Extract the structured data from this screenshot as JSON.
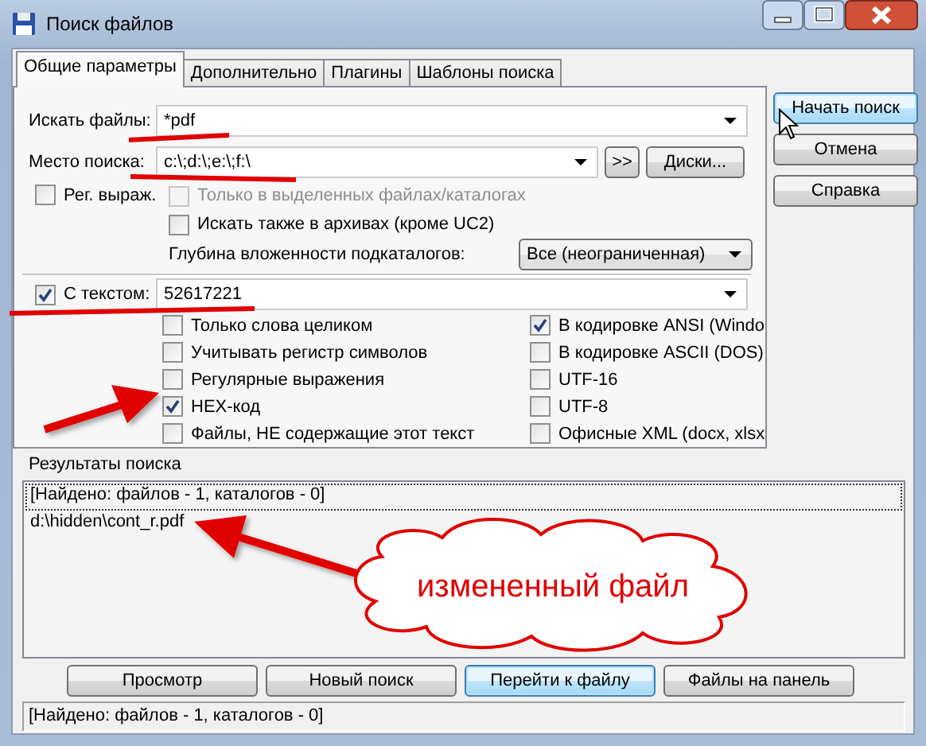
{
  "window": {
    "title": "Поиск файлов"
  },
  "tabs": [
    {
      "label": "Общие параметры",
      "selected": true
    },
    {
      "label": "Дополнительно",
      "selected": false
    },
    {
      "label": "Плагины",
      "selected": false
    },
    {
      "label": "Шаблоны поиска",
      "selected": false
    }
  ],
  "search_for": {
    "label": "Искать файлы:",
    "value": "*pdf"
  },
  "search_in": {
    "label": "Место поиска:",
    "value": "c:\\;d:\\;e:\\;f:\\",
    "browse_button": ">>",
    "drives_button": "Диски..."
  },
  "regex": {
    "label": "Рег. выраж.",
    "checked": false
  },
  "scope_options": [
    {
      "label": "Только в выделенных файлах/каталогах",
      "checked": false,
      "disabled": true
    },
    {
      "label": "Искать также в архивах (кроме UC2)",
      "checked": false,
      "disabled": false
    }
  ],
  "depth": {
    "label": "Глубина вложенности подкаталогов:",
    "value": "Все (неограниченная)"
  },
  "with_text": {
    "label": "С текстом:",
    "checked": true,
    "value": "52617221"
  },
  "text_options": [
    {
      "label": "Только слова целиком",
      "checked": false
    },
    {
      "label": "В кодировке ANSI (Windo",
      "checked": true
    },
    {
      "label": "Учитывать регистр символов",
      "checked": false
    },
    {
      "label": "В кодировке ASCII (DOS)",
      "checked": false
    },
    {
      "label": "Регулярные выражения",
      "checked": false
    },
    {
      "label": "UTF-16",
      "checked": false
    },
    {
      "label": "HEX-код",
      "checked": true
    },
    {
      "label": "UTF-8",
      "checked": false
    },
    {
      "label": "Файлы, НЕ содержащие этот текст",
      "checked": false
    },
    {
      "label": "Офисные XML (docx, xlsx",
      "checked": false
    }
  ],
  "side_buttons": [
    {
      "label": "Начать поиск",
      "default": true
    },
    {
      "label": "Отмена",
      "default": false
    },
    {
      "label": "Справка",
      "default": false
    }
  ],
  "results": {
    "label": "Результаты поиска",
    "rows": [
      {
        "text": "[Найдено: файлов - 1, каталогов - 0]",
        "focused": true
      },
      {
        "text": "d:\\hidden\\cont_r.pdf",
        "focused": false
      }
    ]
  },
  "bottom_buttons": [
    {
      "label": "Просмотр",
      "default": false
    },
    {
      "label": "Новый поиск",
      "default": false
    },
    {
      "label": "Перейти к файлу",
      "default": true
    },
    {
      "label": "Файлы на панель",
      "default": false
    }
  ],
  "status_bar": "[Найдено: файлов - 1, каталогов - 0]",
  "annotation": {
    "callout": "измененный файл"
  }
}
